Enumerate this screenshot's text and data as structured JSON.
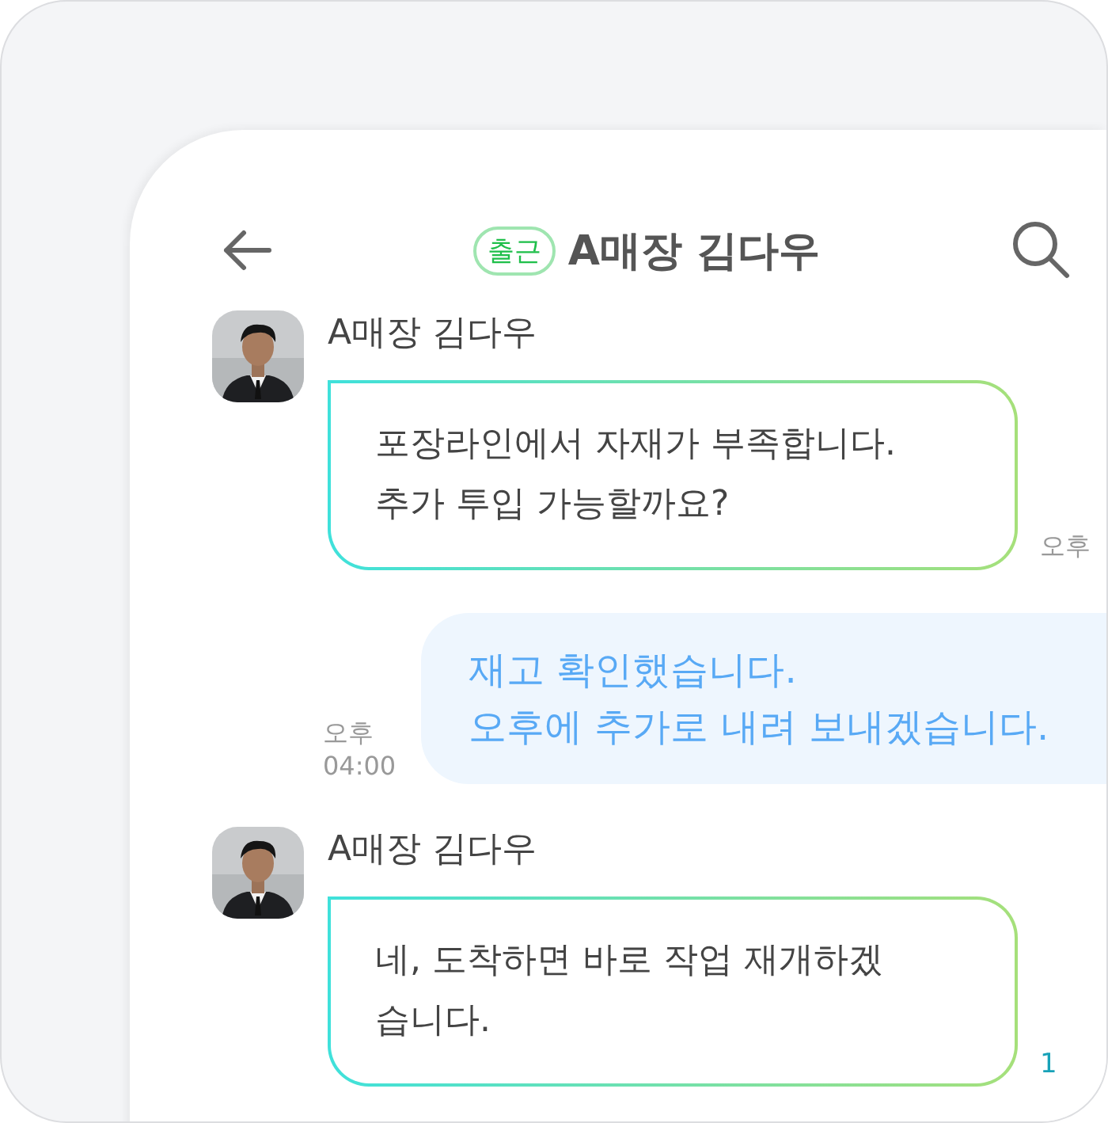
{
  "header": {
    "status_badge": "출근",
    "title": "A매장 김다우"
  },
  "messages": [
    {
      "kind": "incoming",
      "sender": "A매장 김다우",
      "lines": [
        "포장라인에서 자재가 부족합니다.",
        "추가 투입 가능할까요?"
      ],
      "time": "오후"
    },
    {
      "kind": "outgoing",
      "lines": [
        "재고 확인했습니다.",
        "오후에 추가로 내려 보내겠습니다."
      ],
      "time": "오후 04:00"
    },
    {
      "kind": "incoming",
      "sender": "A매장 김다우",
      "lines": [
        "네, 도착하면 바로 작업 재개하겠",
        "습니다."
      ],
      "unread": "1"
    }
  ]
}
